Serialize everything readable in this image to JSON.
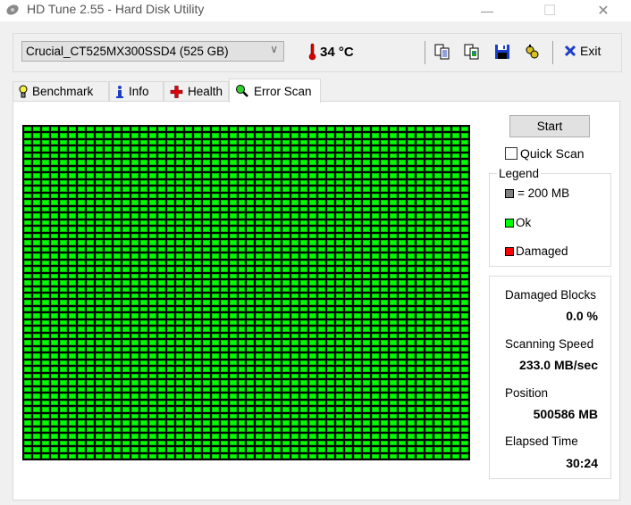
{
  "window": {
    "title": "HD Tune 2.55 - Hard Disk Utility",
    "minimize": "—",
    "maximize": "☐",
    "close": "✕"
  },
  "toolbar": {
    "drive": "Crucial_CT525MX300SSD4 (525 GB)",
    "temperature": "34 °C",
    "exit_label": "Exit"
  },
  "tabs": [
    {
      "label": "Benchmark",
      "icon": "lightbulb-icon"
    },
    {
      "label": "Info",
      "icon": "info-icon"
    },
    {
      "label": "Health",
      "icon": "health-cross-icon"
    },
    {
      "label": "Error Scan",
      "icon": "magnifier-icon",
      "active": true
    }
  ],
  "scan": {
    "start_label": "Start",
    "quick_scan_label": "Quick Scan",
    "quick_scan_checked": false,
    "grid_columns": 50,
    "grid_rows": 50,
    "colors": {
      "ok": "#00ff00",
      "damaged": "#ff0000",
      "block": "#808080"
    }
  },
  "legend": {
    "title": "Legend",
    "block_size": "= 200 MB",
    "ok": "Ok",
    "damaged": "Damaged"
  },
  "stats": {
    "damaged_blocks_label": "Damaged Blocks",
    "damaged_blocks_value": "0.0 %",
    "scanning_speed_label": "Scanning Speed",
    "scanning_speed_value": "233.0 MB/sec",
    "position_label": "Position",
    "position_value": "500586 MB",
    "elapsed_time_label": "Elapsed Time",
    "elapsed_time_value": "30:24"
  }
}
